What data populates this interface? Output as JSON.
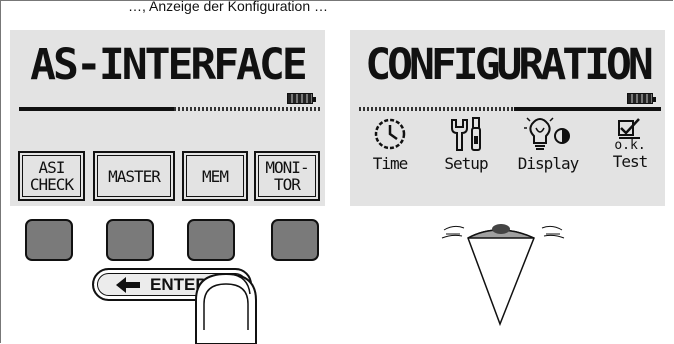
{
  "caption": "…, Anzeige der Konfiguration …",
  "lcd_left": {
    "title": "AS-INTERFACE",
    "keys": [
      {
        "label": "ASI\nCHECK"
      },
      {
        "label": "MASTER"
      },
      {
        "label": "MEM"
      },
      {
        "label": "MONI-\nTOR"
      }
    ],
    "battery_icon": "battery-icon"
  },
  "lcd_right": {
    "title": "CONFIGURATION",
    "items": [
      {
        "icon": "clock-icon",
        "label": "Time"
      },
      {
        "icon": "tools-icon",
        "label": "Setup"
      },
      {
        "icon": "bulb-contrast-icon",
        "label": "Display"
      },
      {
        "icon": "checkbox-icon",
        "label": "Test",
        "sub": "o.k."
      }
    ],
    "battery_icon": "battery-icon"
  },
  "enter_key": {
    "label": "ENTER",
    "icon": "arrow-left-icon"
  },
  "colors": {
    "lcd": "#e3e3e3",
    "button": "#7a7a7a"
  }
}
